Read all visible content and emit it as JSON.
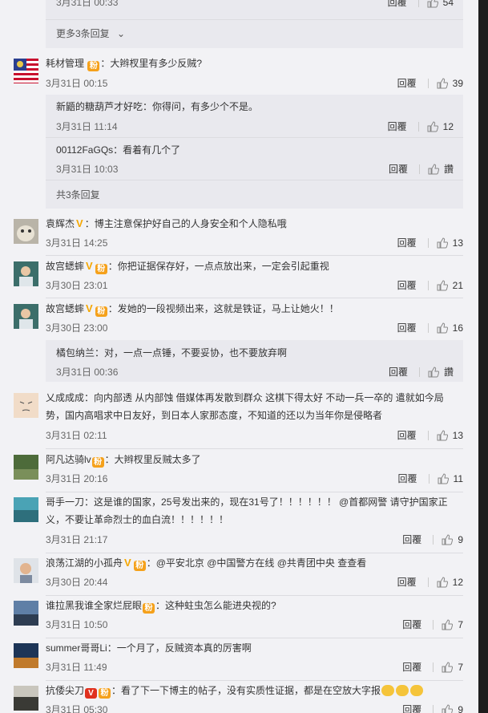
{
  "top_item": {
    "date_partial": "3月31日 00:33",
    "reply": "回覆",
    "likes": "54"
  },
  "top_more": "更多3条回复",
  "comments": [
    {
      "name": "耗材管理",
      "text": "：大辫杈里有多少反贼?",
      "date": "3月31日 00:15",
      "reply": "回覆",
      "likes": "39",
      "subs": [
        {
          "name": "新鼯的糖葫芦才好吃",
          "text": "：你得问，有多少个不是。",
          "date": "3月31日 11:14",
          "reply": "回覆",
          "likes": "12"
        },
        {
          "name": "00112FaGQs",
          "text": "：看着有几个了",
          "date": "3月31日 10:03",
          "reply": "回覆",
          "likes": "讚"
        }
      ],
      "sub_total": "共3条回复"
    },
    {
      "name": "袁辉杰",
      "text": "：博主注意保护好自己的人身安全和个人隐私哦",
      "date": "3月31日 14:25",
      "reply": "回覆",
      "likes": "13"
    },
    {
      "name": "故宫蟋蟀",
      "text": "：你把证据保存好，一点点放出来，一定会引起重视",
      "date": "3月30日 23:01",
      "reply": "回覆",
      "likes": "21"
    },
    {
      "name": "故宫蟋蟀",
      "text": "：发她的一段视频出来，这就是铁证，马上让她火！！",
      "date": "3月30日 23:00",
      "reply": "回覆",
      "likes": "16",
      "subs": [
        {
          "name": "橘包纳兰",
          "text": "：对，一点一点锤，不要妥协，也不要放弃啊",
          "date": "3月31日 00:36",
          "reply": "回覆",
          "likes": "讚"
        }
      ]
    },
    {
      "name": "乂成成成",
      "text": "：向内部透 从内部蚀 借媒体再发散到群众 这棋下得太好 不动一兵一卒的 遣就如今局势，国内高唱求中日友好，到日本人家那态度，不知道的还以为当年你是侵略者",
      "date": "3月31日 02:11",
      "reply": "回覆",
      "likes": "13"
    },
    {
      "name": "阿凡达骑lv",
      "text": "：大辫杈里反贼太多了",
      "date": "3月31日 20:16",
      "reply": "回覆",
      "likes": "11"
    },
    {
      "name": "哥手一刀",
      "text": "：这是谁的国家，25号发出来的，现在31号了！！！！！！ @首都网警 请守护国家正义，不要让革命烈士的血白流！！！！！！",
      "date": "3月31日 21:17",
      "reply": "回覆",
      "likes": "9"
    },
    {
      "name": "浪荡江湖的小孤舟",
      "text": "：@平安北京 @中国警方在线 @共青团中央 查查看",
      "date": "3月30日 20:44",
      "reply": "回覆",
      "likes": "12"
    },
    {
      "name": "谁拉黑我谁全家烂屁眼",
      "text": "：这种蛀虫怎么能进央视的?",
      "date": "3月31日 10:50",
      "reply": "回覆",
      "likes": "7"
    },
    {
      "name": "summer哥哥Li",
      "text": "：一个月了，反贼资本真的厉害啊",
      "date": "3月31日 11:49",
      "reply": "回覆",
      "likes": "7"
    },
    {
      "name": "抗倭尖刀",
      "text": "：看了下一下博主的帖子，没有实质性证据，都是在空放大字报",
      "date": "3月31日 05:30",
      "reply": "回覆",
      "likes": "9"
    }
  ],
  "colors": {
    "name": "#333333",
    "link": "#eb7350",
    "badge": "#f5a11b",
    "vip": "#f5a700",
    "panel": "#f2f2f5",
    "subpanel": "#e9e9ee"
  }
}
